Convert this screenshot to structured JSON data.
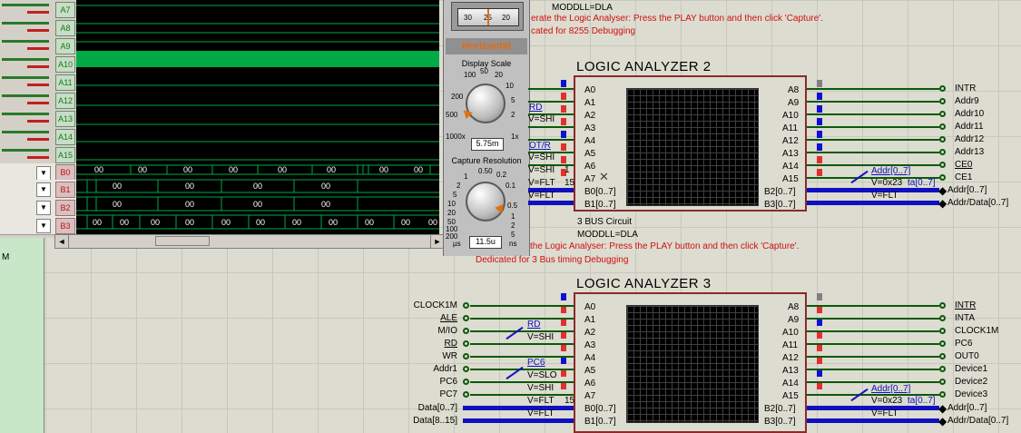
{
  "left_panel": {
    "channels": [
      "A7",
      "A8",
      "A9",
      "A10",
      "A11",
      "A12",
      "A13",
      "A14",
      "A15"
    ],
    "buses": [
      "B0",
      "B1",
      "B2",
      "B3"
    ],
    "side_text": "M"
  },
  "waveform": {
    "bus0_values": [
      "00",
      "00",
      "00",
      "00",
      "00",
      "00",
      "00",
      "00"
    ],
    "bus1_values": [
      "00",
      "00",
      "00",
      "00"
    ],
    "bus2_values": [
      "00",
      "00",
      "00",
      "00"
    ],
    "bus3_values": [
      "00",
      "00",
      "00",
      "00",
      "00",
      "00",
      "00",
      "00",
      "00",
      "00",
      "00"
    ]
  },
  "controls": {
    "top_dial_ticks": [
      "30",
      "25",
      "20"
    ],
    "horizontal_label": "Horizontal",
    "display_scale_label": "Display Scale",
    "display_scale_ticks": [
      "100",
      "50",
      "20",
      "10",
      "5",
      "2",
      "1",
      "1000x",
      "1x",
      "500",
      "200"
    ],
    "display_scale_value": "5.75m",
    "capture_resolution_label": "Capture Resolution",
    "capture_ticks": [
      "0.50",
      "0.2",
      "0.1",
      "1",
      "2",
      "5",
      "10",
      "20",
      "50",
      "100",
      "200",
      "0.5",
      "1",
      "2",
      "5"
    ],
    "capture_units_left": "µs",
    "capture_units_right": "ns",
    "capture_value": "11.5u"
  },
  "schematic": {
    "top_note_1": "MODDLL=DLA",
    "top_note_red_1": "erate the Logic Analyser: Press the PLAY button and then click 'Capture'.",
    "top_note_red_2": "cated for 8255 Debugging",
    "la2": {
      "title": "LOGIC ANALYZER 2",
      "left_pins": [
        "A0",
        "A1",
        "A2",
        "A3",
        "A4",
        "A5",
        "A6",
        "A7",
        "B0[0..7]",
        "B1[0..7]"
      ],
      "right_pins": [
        "A8",
        "A9",
        "A10",
        "A11",
        "A12",
        "A13",
        "A14",
        "A15",
        "B2[0..7]",
        "B3[0..7]"
      ],
      "right_nets": [
        "INTR",
        "Addr9",
        "Addr10",
        "Addr11",
        "Addr12",
        "Addr13",
        "CE0",
        "CE1",
        "Addr[0..7]",
        "Addr/Data[0..7]"
      ],
      "left_probe_labels": [
        "RD",
        "V=SHI",
        "OT/R",
        "V=SHI",
        "V=SHI",
        "V=FLT",
        "V=FLT"
      ],
      "left_probe_extra": [
        "1",
        "15"
      ],
      "right_probe_labels": [
        "Addr[0..7]",
        "V=0x23",
        "ta[0..7]",
        "V=FLT"
      ],
      "circuit_label": "3 BUS Circuit",
      "model_label": "MODDLL=DLA",
      "red_note_1": "the Logic Analyser: Press the PLAY button and then click 'Capture'.",
      "red_note_2": "Dedicated for 3 Bus timing Debugging"
    },
    "la3": {
      "title": "LOGIC ANALYZER 3",
      "left_pins": [
        "A0",
        "A1",
        "A2",
        "A3",
        "A4",
        "A5",
        "A6",
        "A7",
        "B0[0..7]",
        "B1[0..7]"
      ],
      "right_pins": [
        "A8",
        "A9",
        "A10",
        "A11",
        "A12",
        "A13",
        "A14",
        "A15",
        "B2[0..7]",
        "B3[0..7]"
      ],
      "left_nets": [
        "CLOCK1M",
        "ALE",
        "M/IO",
        "RD",
        "WR",
        "Addr1",
        "PC6",
        "PC7",
        "Data[0..7]",
        "Data[8..15]"
      ],
      "right_nets": [
        "INTR",
        "INTA",
        "CLOCK1M",
        "PC6",
        "OUT0",
        "Device1",
        "Device2",
        "Device3",
        "Addr[0..7]",
        "Addr/Data[0..7]"
      ],
      "left_probe_labels": [
        "RD",
        "V=SHI",
        "PC6",
        "V=SLO",
        "V=SHI",
        "V=FLT",
        "V=FLT"
      ],
      "left_probe_extra": [
        "15"
      ],
      "right_probe_labels": [
        "Addr[0..7]",
        "V=0x23",
        "ta[0..7]",
        "V=FLT"
      ]
    }
  }
}
